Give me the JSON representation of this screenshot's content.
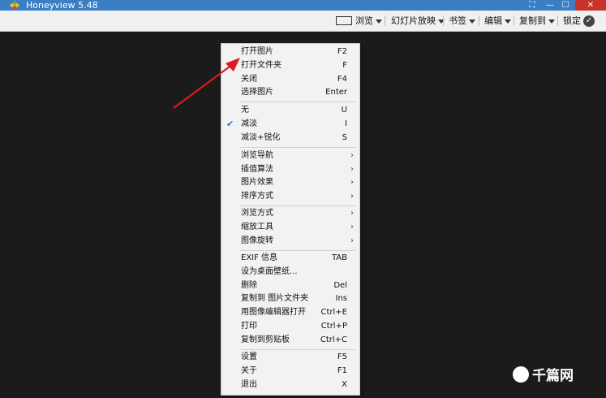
{
  "window": {
    "title": "Honeyview 5.48",
    "minimize": "—",
    "maximize": "☐",
    "close": "✕"
  },
  "toolbar": {
    "browse": "浏览",
    "slideshow": "幻灯片放映",
    "bookmarks": "书签",
    "edit": "编辑",
    "copy_to": "复制到",
    "lock": "锁定"
  },
  "menu": {
    "open_image": {
      "label": "打开图片",
      "key": "F2"
    },
    "open_folder": {
      "label": "打开文件夹",
      "key": "F"
    },
    "close": {
      "label": "关闭",
      "key": "F4"
    },
    "select_image": {
      "label": "选择图片",
      "key": "Enter"
    },
    "none": {
      "label": "无",
      "key": "U"
    },
    "fade": {
      "label": "减淡",
      "key": "I",
      "checked": true
    },
    "fade_sharpen": {
      "label": "减淡+锐化",
      "key": "S"
    },
    "browse_nav": {
      "label": "浏览导航"
    },
    "interpolation": {
      "label": "插值算法"
    },
    "image_effects": {
      "label": "图片效果"
    },
    "sort_order": {
      "label": "排序方式"
    },
    "browse_mode": {
      "label": "浏览方式"
    },
    "zoom_tools": {
      "label": "缩放工具"
    },
    "image_rotate": {
      "label": "图像旋转"
    },
    "exif_info": {
      "label": "EXIF 信息",
      "key": "TAB"
    },
    "set_wallpaper": {
      "label": "设为桌面壁纸..."
    },
    "delete": {
      "label": "删除",
      "key": "Del"
    },
    "copy_to_image_folder": {
      "label": "复制到 图片文件夹",
      "key": "Ins"
    },
    "open_with_editor": {
      "label": "用图像编辑器打开",
      "key": "Ctrl+E"
    },
    "print": {
      "label": "打印",
      "key": "Ctrl+P"
    },
    "copy_clipboard": {
      "label": "复制到剪贴板",
      "key": "Ctrl+C"
    },
    "settings": {
      "label": "设置",
      "key": "F5"
    },
    "about": {
      "label": "关于",
      "key": "F1"
    },
    "exit": {
      "label": "退出",
      "key": "X"
    },
    "submenu_arrow": "›",
    "check_mark": "✔"
  },
  "watermark": {
    "text": "千篇网"
  },
  "colors": {
    "titlebar": "#3a7fc4",
    "background": "#1b1b1b",
    "arrow": "#d81b1b",
    "check": "#2a78c8"
  }
}
